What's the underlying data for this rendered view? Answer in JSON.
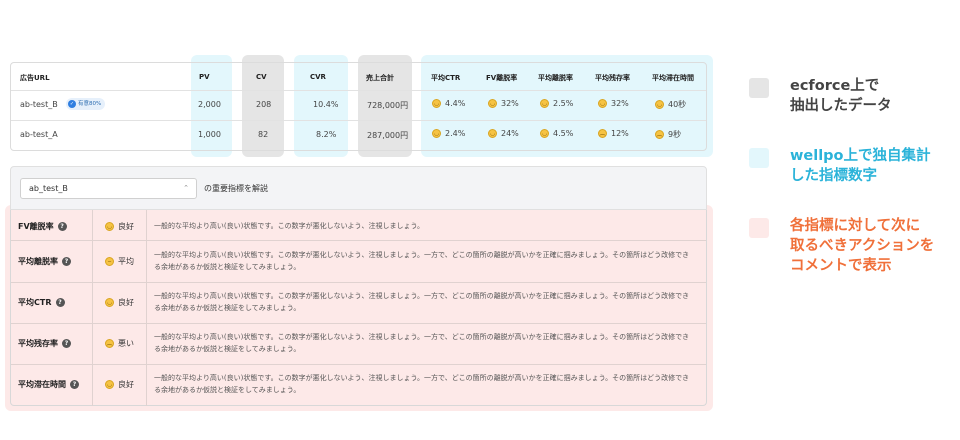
{
  "table": {
    "headers": {
      "url": "広告URL",
      "pv": "PV",
      "cv": "CV",
      "cvr": "CVR",
      "sales": "売上合計",
      "ctr": "平均CTR",
      "fv": "FV離脱率",
      "exit": "平均離脱率",
      "remain": "平均残存率",
      "stay": "平均滞在時間"
    },
    "rows": [
      {
        "url": "ab-test_B",
        "badge": "有意80%",
        "pv": "2,000",
        "cv": "208",
        "cvr": "10.4%",
        "sales": "728,000円",
        "ctr": "4.4%",
        "fv": "32%",
        "exit": "2.5%",
        "remain": "32%",
        "stay": "40秒"
      },
      {
        "url": "ab-test_A",
        "pv": "1,000",
        "cv": "82",
        "cvr": "8.2%",
        "sales": "287,000円",
        "ctr": "2.4%",
        "fv": "24%",
        "exit": "4.5%",
        "remain": "12%",
        "stay": "9秒"
      }
    ]
  },
  "selector": {
    "value": "ab_test_B",
    "description": "の重要指標を解説"
  },
  "indicators": [
    {
      "name": "FV離脱率",
      "status": "良好",
      "comment": "一般的な平均より高い(良い)状態です。この数字が悪化しないよう、注視しましょう。"
    },
    {
      "name": "平均離脱率",
      "status": "平均",
      "comment": "一般的な平均より高い(良い)状態です。この数字が悪化しないよう、注視しましょう。一方で、どこの箇所の離脱が高いかを正確に掴みましょう。その箇所はどう改修できる余地があるか仮説と検証をしてみましょう。"
    },
    {
      "name": "平均CTR",
      "status": "良好",
      "comment": "一般的な平均より高い(良い)状態です。この数字が悪化しないよう、注視しましょう。一方で、どこの箇所の離脱が高いかを正確に掴みましょう。その箇所はどう改修できる余地があるか仮説と検証をしてみましょう。"
    },
    {
      "name": "平均残存率",
      "status": "悪い",
      "comment": "一般的な平均より高い(良い)状態です。この数字が悪化しないよう、注視しましょう。一方で、どこの箇所の離脱が高いかを正確に掴みましょう。その箇所はどう改修できる余地があるか仮説と検証をしてみましょう。"
    },
    {
      "name": "平均滞在時間",
      "status": "良好",
      "comment": "一般的な平均より高い(良い)状態です。この数字が悪化しないよう、注視しましょう。一方で、どこの箇所の離脱が高いかを正確に掴みましょう。その箇所はどう改修できる余地があるか仮説と検証をしてみましょう。"
    }
  ],
  "legend": [
    {
      "line1": "ecforce上で",
      "line2": "抽出したデータ",
      "line3": "",
      "color": "#e5e5e5",
      "text_color": "#444444"
    },
    {
      "line1": "wellpo上で独自集計",
      "line2": "した指標数字",
      "line3": "",
      "color": "#e3f7fc",
      "text_color": "#2bb3d9"
    },
    {
      "line1": "各指標に対して次に",
      "line2": "取るべきアクションを",
      "line3": "コメントで表示",
      "color": "#fde9e8",
      "text_color": "#f0703a"
    }
  ]
}
